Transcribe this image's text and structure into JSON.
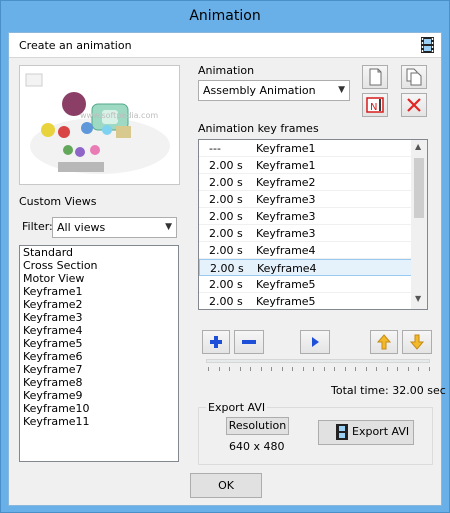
{
  "window": {
    "title": "Animation"
  },
  "header": {
    "title": "Create an animation",
    "icon": "film-icon"
  },
  "animation": {
    "label": "Animation",
    "selected": "Assembly Animation",
    "keyframes_label": "Animation key frames",
    "keyframes": [
      {
        "time": "---",
        "name": "Keyframe1"
      },
      {
        "time": "2.00 s",
        "name": "Keyframe1"
      },
      {
        "time": "2.00 s",
        "name": "Keyframe2"
      },
      {
        "time": "2.00 s",
        "name": "Keyframe3"
      },
      {
        "time": "2.00 s",
        "name": "Keyframe3"
      },
      {
        "time": "2.00 s",
        "name": "Keyframe3"
      },
      {
        "time": "2.00 s",
        "name": "Keyframe4"
      },
      {
        "time": "2.00 s",
        "name": "Keyframe4"
      },
      {
        "time": "2.00 s",
        "name": "Keyframe5"
      },
      {
        "time": "2.00 s",
        "name": "Keyframe5"
      }
    ],
    "selected_keyframe_index": 7,
    "total_time": "Total time: 32.00 sec"
  },
  "custom_views": {
    "label": "Custom Views",
    "filter_label": "Filter:",
    "filter_value": "All views",
    "items": [
      "Standard",
      "Cross Section",
      "Motor View",
      "Keyframe1",
      "Keyframe2",
      "Keyframe3",
      "Keyframe4",
      "Keyframe5",
      "Keyframe6",
      "Keyframe7",
      "Keyframe8",
      "Keyframe9",
      "Keyframe10",
      "Keyframe11"
    ]
  },
  "export": {
    "group_label": "Export AVI",
    "resolution_button": "Resolution",
    "resolution_value": "640 x 480",
    "export_button": "Export AVI"
  },
  "footer": {
    "ok": "OK"
  },
  "preview": {
    "watermark": "www.softpedia.com"
  }
}
